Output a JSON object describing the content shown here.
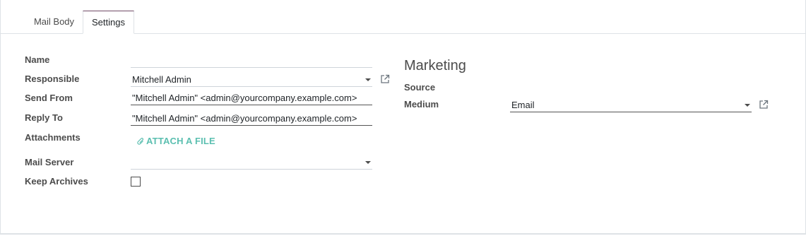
{
  "tabs": [
    {
      "label": "Mail Body"
    },
    {
      "label": "Settings"
    }
  ],
  "left": {
    "name_label": "Name",
    "name_value": "",
    "responsible_label": "Responsible",
    "responsible_value": "Mitchell Admin",
    "send_from_label": "Send From",
    "send_from_value": "\"Mitchell Admin\" <admin@yourcompany.example.com>",
    "reply_to_label": "Reply To",
    "reply_to_value": "\"Mitchell Admin\" <admin@yourcompany.example.com>",
    "attachments_label": "Attachments",
    "attach_button": "ATTACH A FILE",
    "mail_server_label": "Mail Server",
    "mail_server_value": "",
    "keep_archives_label": "Keep Archives",
    "keep_archives_checked": false
  },
  "marketing": {
    "title": "Marketing",
    "source_label": "Source",
    "medium_label": "Medium",
    "medium_value": "Email"
  },
  "icons": {
    "external_link": "external-link-icon",
    "paperclip": "paperclip-icon",
    "dropdown": "caret-down-icon"
  },
  "colors": {
    "accent": "#714B67",
    "link": "#5bbfb0",
    "label": "#4c4c4c"
  }
}
